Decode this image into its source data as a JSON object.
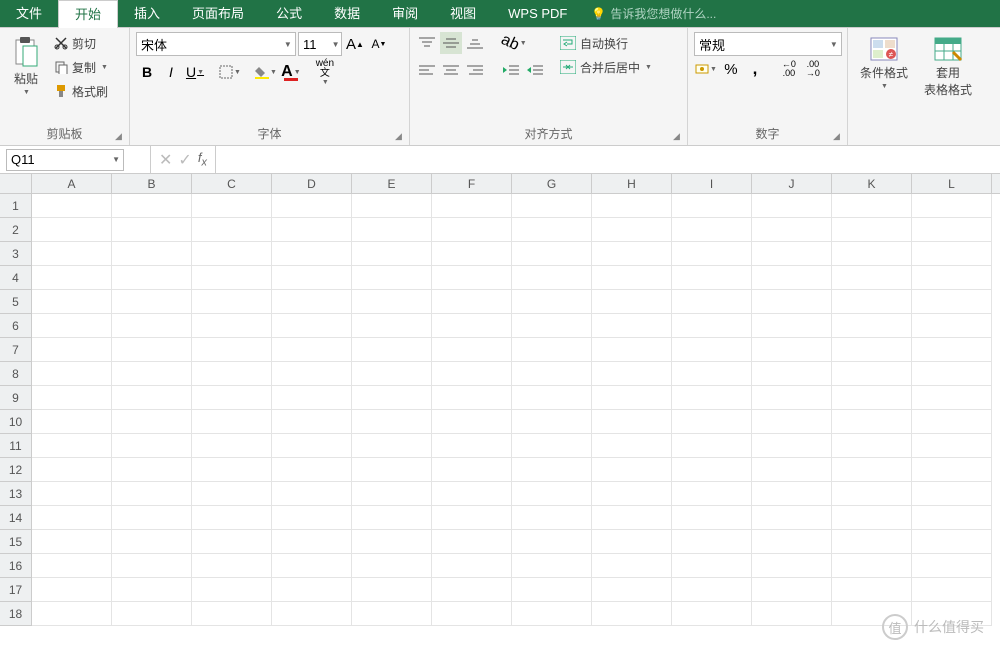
{
  "tabs": {
    "file": "文件",
    "home": "开始",
    "insert": "插入",
    "layout": "页面布局",
    "formula": "公式",
    "data": "数据",
    "review": "审阅",
    "view": "视图",
    "pdf": "WPS PDF"
  },
  "tellme": "告诉我您想做什么...",
  "clipboard": {
    "label": "剪贴板",
    "paste": "粘贴",
    "cut": "剪切",
    "copy": "复制",
    "format_painter": "格式刷"
  },
  "font": {
    "label": "字体",
    "name": "宋体",
    "size": "11",
    "bold": "B",
    "italic": "I",
    "underline": "U",
    "phonetic": "wén",
    "pinyin": "文"
  },
  "align": {
    "label": "对齐方式",
    "wrap": "自动换行",
    "merge": "合并后居中"
  },
  "number": {
    "label": "数字",
    "format": "常规",
    "percent": "%",
    "comma": ","
  },
  "styles": {
    "cond": "条件格式",
    "table": "套用\n表格格式"
  },
  "cell_ref": "Q11",
  "columns": [
    "A",
    "B",
    "C",
    "D",
    "E",
    "F",
    "G",
    "H",
    "I",
    "J",
    "K",
    "L"
  ],
  "rows": [
    1,
    2,
    3,
    4,
    5,
    6,
    7,
    8,
    9,
    10,
    11,
    12,
    13,
    14,
    15,
    16,
    17,
    18
  ],
  "watermark": {
    "badge": "值",
    "text": "什么值得买"
  }
}
